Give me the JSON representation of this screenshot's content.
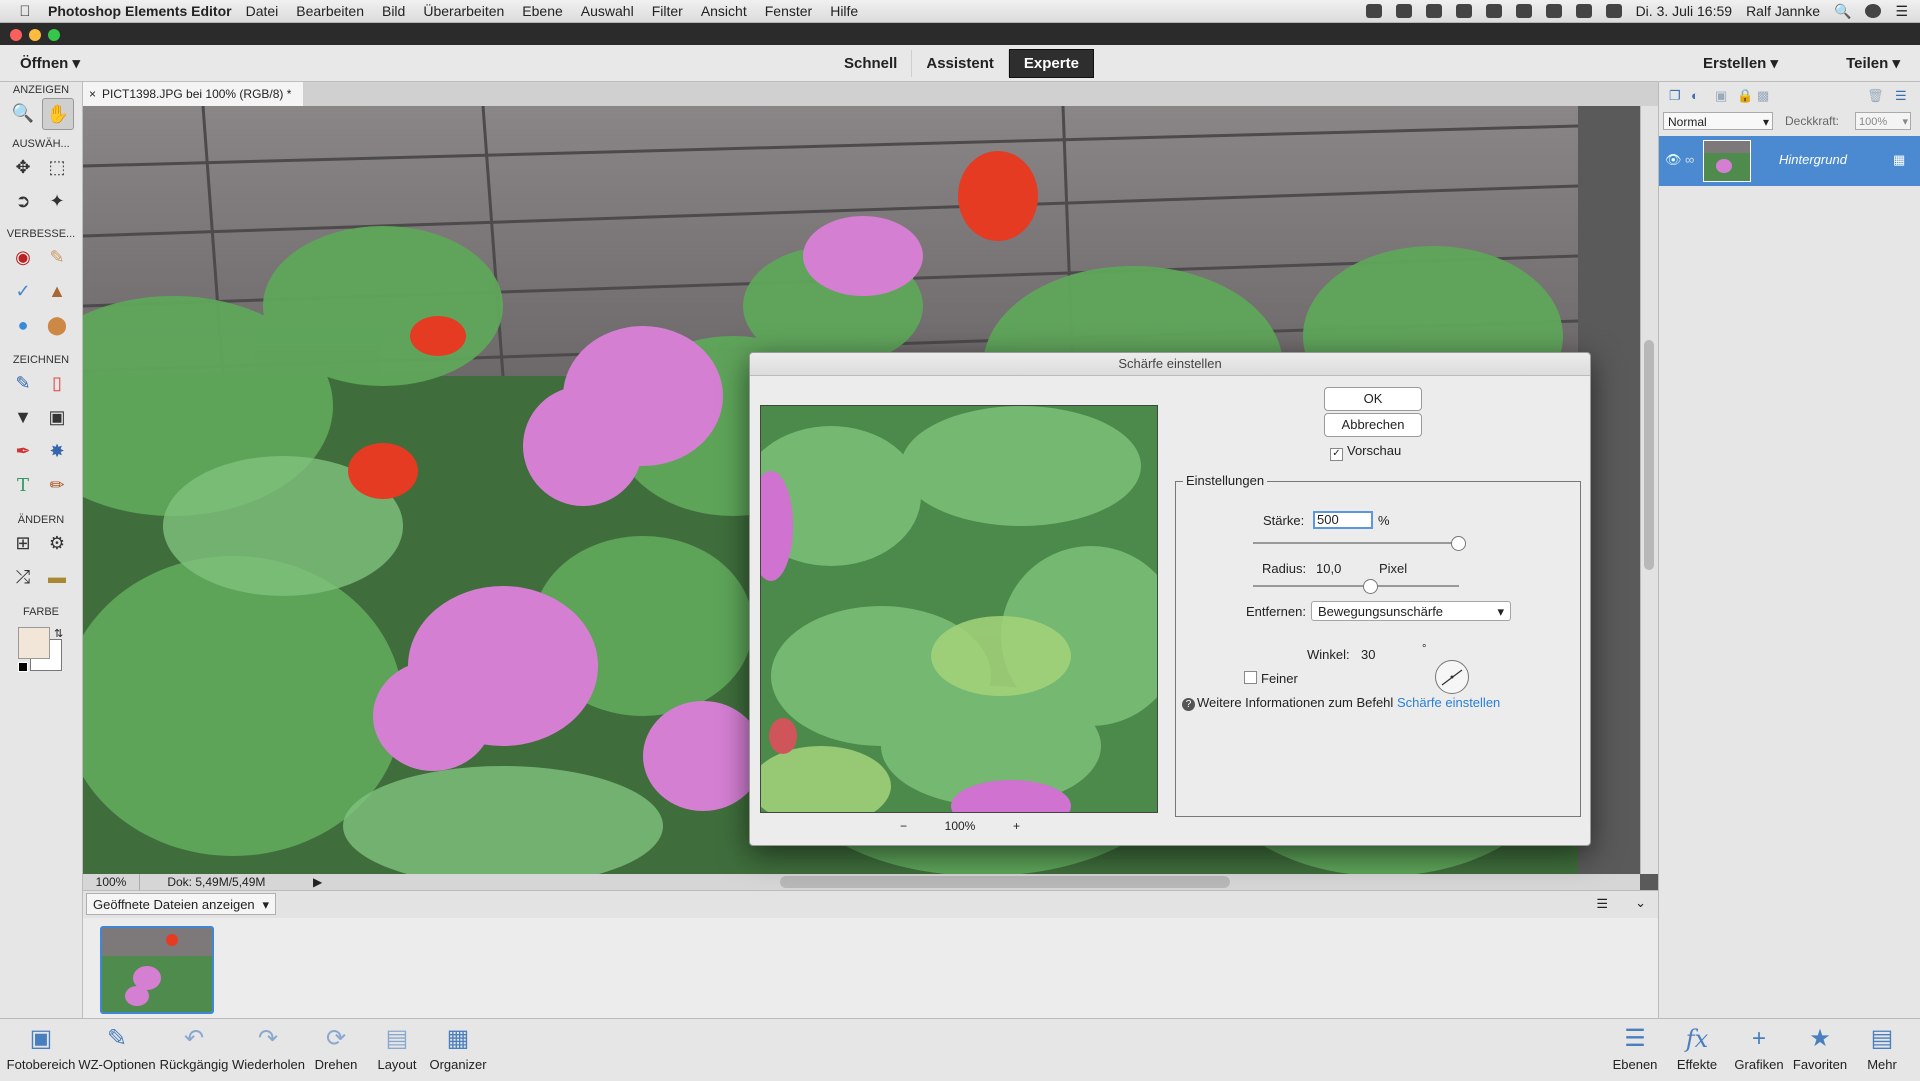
{
  "menubar": {
    "app_name": "Photoshop Elements Editor",
    "items": [
      "Datei",
      "Bearbeiten",
      "Bild",
      "Überarbeiten",
      "Ebene",
      "Auswahl",
      "Filter",
      "Ansicht",
      "Fenster",
      "Hilfe"
    ],
    "clock": "Di. 3. Juli 16:59",
    "user": "Ralf Jannke"
  },
  "modebar": {
    "open_label": "Öffnen",
    "modes": [
      "Schnell",
      "Assistent",
      "Experte"
    ],
    "active_mode": "Experte",
    "create_label": "Erstellen",
    "share_label": "Teilen"
  },
  "toolbar": {
    "sections": [
      "ANZEIGEN",
      "AUSWÄH...",
      "VERBESSE...",
      "ZEICHNEN",
      "ÄNDERN",
      "FARBE"
    ]
  },
  "document": {
    "tab_title": "PICT1398.JPG bei 100% (RGB/8) *",
    "zoom": "100%",
    "doc_size": "Dok: 5,49M/5,49M"
  },
  "project_bin": {
    "dropdown": "Geöffnete Dateien anzeigen"
  },
  "layers": {
    "blend_mode": "Normal",
    "opacity_label": "Deckkraft:",
    "opacity_value": "100%",
    "layer_name": "Hintergrund"
  },
  "dialog": {
    "title": "Schärfe einstellen",
    "ok": "OK",
    "cancel": "Abbrechen",
    "preview_label": "Vorschau",
    "preview_checked": true,
    "preview_zoom": "100%",
    "zoom_out": "−",
    "zoom_in": "+",
    "group_label": "Einstellungen",
    "amount_label": "Stärke:",
    "amount_value": "500",
    "amount_unit": "%",
    "amount_max": 500,
    "radius_label": "Radius:",
    "radius_value": "10,0",
    "radius_unit": "Pixel",
    "radius_fraction": 0.54,
    "remove_label": "Entfernen:",
    "remove_value": "Bewegungsunschärfe",
    "angle_label": "Winkel:",
    "angle_value": "30",
    "angle_unit": "°",
    "finer_label": "Feiner",
    "finer_checked": false,
    "info_text": "Weitere Informationen zum Befehl",
    "info_link": "Schärfe einstellen"
  },
  "taskbar": {
    "left": [
      "Fotobereich",
      "WZ-Optionen",
      "Rückgängig",
      "Wiederholen",
      "Drehen",
      "Layout",
      "Organizer"
    ],
    "right": [
      "Ebenen",
      "Effekte",
      "Grafiken",
      "Favoriten",
      "Mehr"
    ]
  },
  "colors": {
    "accent": "#3e86d6",
    "layer_selected": "#4b8ad1",
    "link": "#2a80d8"
  }
}
